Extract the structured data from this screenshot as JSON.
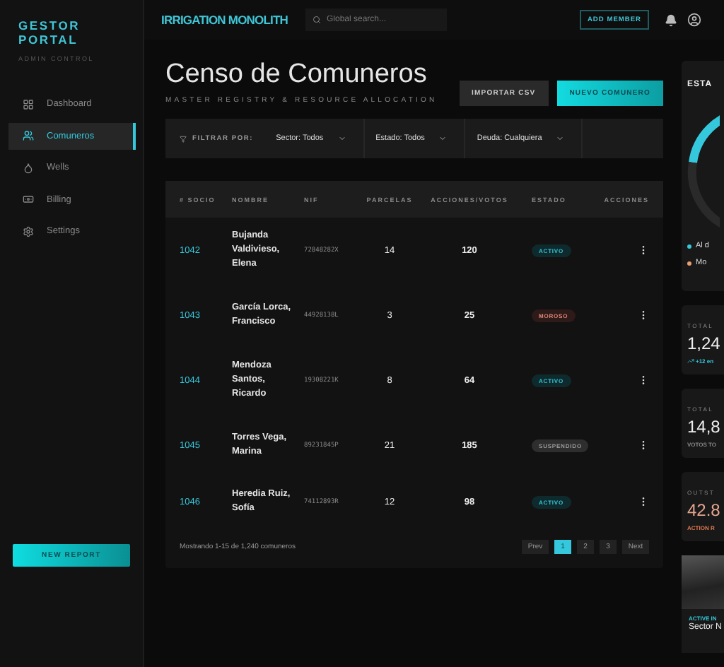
{
  "sidebar": {
    "brand": "GESTOR PORTAL",
    "subtitle": "ADMIN CONTROL",
    "items": [
      {
        "label": "Dashboard",
        "selected": false
      },
      {
        "label": "Comuneros",
        "selected": true
      },
      {
        "label": "Wells",
        "selected": false
      },
      {
        "label": "Billing",
        "selected": false
      },
      {
        "label": "Settings",
        "selected": false
      }
    ],
    "button": "NEW REPORT"
  },
  "topbar": {
    "title": "IRRIGATION MONOLITH",
    "search": {
      "placeholder": "Global search..."
    },
    "button": "ADD MEMBER"
  },
  "header": {
    "title": "Censo de Comuneros",
    "subtitle": "MASTER REGISTRY & RESOURCE ALLOCATION",
    "buttons": [
      {
        "label": "IMPORTAR CSV",
        "kind": "secondary"
      },
      {
        "label": "NUEVO COMUNERO",
        "kind": "primary"
      }
    ]
  },
  "filters": {
    "label": "FILTRAR POR:",
    "dropdowns": [
      "Sector: Todos",
      "Estado: Todos",
      "Deuda: Cualquiera"
    ]
  },
  "table": {
    "columns": [
      "# SOCIO",
      "NOMBRE",
      "NIF",
      "PARCELAS",
      "ACCIONES/VOTOS",
      "ESTADO",
      "ACCIONES"
    ],
    "rows": [
      {
        "id": "1042",
        "name": "Bujanda Valdivieso, Elena",
        "nif": "72848282X",
        "parcels": "14",
        "votes": "120",
        "status": "ACTIVO",
        "kind": "active"
      },
      {
        "id": "1043",
        "name": "García Lorca, Francisco",
        "nif": "44928138L",
        "parcels": "3",
        "votes": "25",
        "status": "MOROSO",
        "kind": "debt"
      },
      {
        "id": "1044",
        "name": "Mendoza Santos, Ricardo",
        "nif": "19308221K",
        "parcels": "8",
        "votes": "64",
        "status": "ACTIVO",
        "kind": "active"
      },
      {
        "id": "1045",
        "name": "Torres Vega, Marina",
        "nif": "89231845P",
        "parcels": "21",
        "votes": "185",
        "status": "SUSPENDIDO",
        "kind": "suspended"
      },
      {
        "id": "1046",
        "name": "Heredia Ruiz, Sofía",
        "nif": "74112893R",
        "parcels": "12",
        "votes": "98",
        "status": "ACTIVO",
        "kind": "active"
      }
    ]
  },
  "pagination": {
    "summary": "Mostrando 1-15 de 1,240 comuneros",
    "pages": [
      {
        "label": "Prev",
        "selected": false
      },
      {
        "label": "1",
        "selected": true
      },
      {
        "label": "2",
        "selected": false
      },
      {
        "label": "3",
        "selected": false
      },
      {
        "label": "Next",
        "selected": false
      }
    ]
  },
  "right": {
    "status_card": {
      "title": "ESTA",
      "legend": [
        {
          "label": "Al d",
          "color": "#35c8dc"
        },
        {
          "label": "Mo",
          "color": "#e8a070"
        }
      ]
    },
    "stats": [
      {
        "label": "TOTAL",
        "value": "1,24",
        "note": "+12 en",
        "kind": "trend"
      },
      {
        "label": "TOTAL",
        "value": "14,8",
        "note": "VOTOS TO",
        "kind": "plain"
      },
      {
        "label": "OUTST",
        "value": "42.8",
        "note": "ACTION R",
        "kind": "alert"
      }
    ],
    "image_card": {
      "tag": "ACTIVE IN",
      "title": "Sector N"
    }
  }
}
